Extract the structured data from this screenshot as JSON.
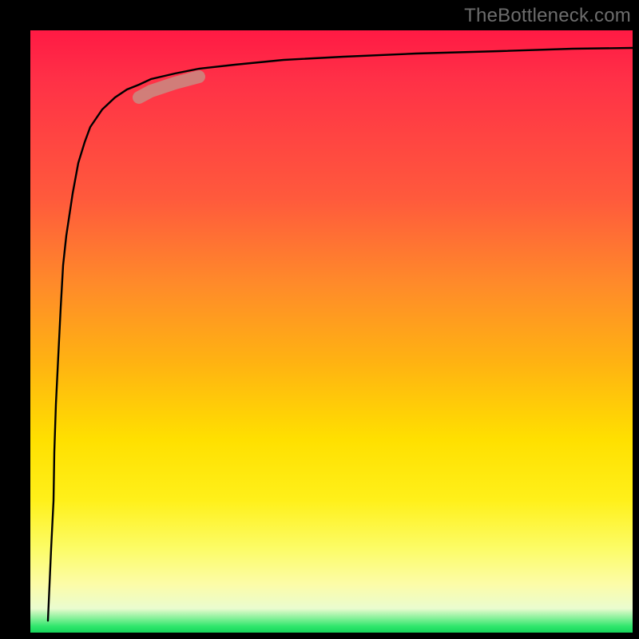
{
  "watermark": "TheBottleneck.com",
  "chart_data": {
    "type": "line",
    "title": "",
    "xlabel": "",
    "ylabel": "",
    "xlim": [
      0,
      100
    ],
    "ylim": [
      0,
      100
    ],
    "grid": false,
    "series": [
      {
        "name": "bottleneck-curve",
        "x": [
          3,
          3.2,
          3.5,
          3.8,
          4.0,
          4.3,
          4.6,
          5.0,
          5.5,
          6.0,
          7.0,
          8.0,
          9.0,
          10.0,
          12.0,
          14.0,
          16.0,
          18.0,
          20.0,
          24.0,
          28.0,
          34.0,
          42.0,
          52.0,
          64.0,
          78.0,
          90.0,
          100.0
        ],
        "y": [
          2,
          6,
          12,
          20,
          28,
          36,
          44,
          52,
          59,
          64,
          71,
          76,
          79.5,
          82,
          85,
          87,
          88.3,
          89.2,
          90,
          91,
          91.8,
          92.5,
          93.2,
          93.8,
          94.3,
          94.7,
          95,
          95.2
        ]
      }
    ],
    "annotations": [
      {
        "name": "highlight-segment",
        "type": "segment-marker",
        "color": "#c98b83",
        "from_x": 18.0,
        "from_y": 87.0,
        "to_x": 28.0,
        "to_y": 90.8
      }
    ],
    "background_gradient": {
      "top_color": "#ff1a44",
      "bottom_color": "#17d65c"
    }
  }
}
